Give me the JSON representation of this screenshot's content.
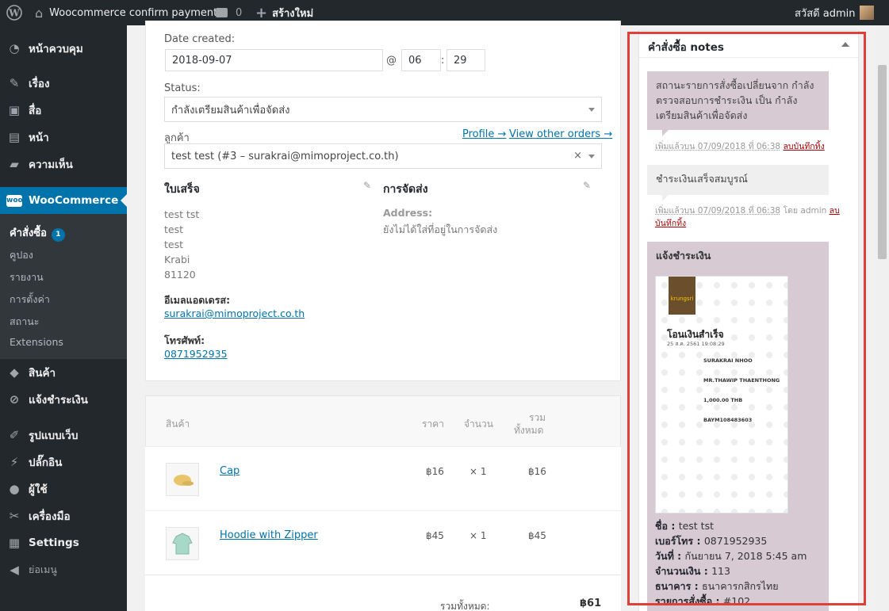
{
  "admin_bar": {
    "site_name": "Woocommerce confirm payment",
    "comments_count": "0",
    "new_label": "สร้างใหม่",
    "greeting": "สวัสดี admin"
  },
  "menu": {
    "items": [
      {
        "label": "หน้าควบคุม",
        "icon": "dashboard-icon"
      },
      {
        "label": "เรื่อง",
        "icon": "pin-icon"
      },
      {
        "label": "สื่อ",
        "icon": "media-icon"
      },
      {
        "label": "หน้า",
        "icon": "page-icon"
      },
      {
        "label": "ความเห็น",
        "icon": "comment-icon"
      },
      {
        "label": "WooCommerce",
        "icon": "woo-icon"
      },
      {
        "label": "สินค้า",
        "icon": "box-icon"
      },
      {
        "label": "แจ้งชำระเงิน",
        "icon": "link-icon"
      },
      {
        "label": "รูปแบบเว็บ",
        "icon": "brush-icon"
      },
      {
        "label": "ปลั๊กอิน",
        "icon": "plugin-icon"
      },
      {
        "label": "ผู้ใช้",
        "icon": "user-icon"
      },
      {
        "label": "เครื่องมือ",
        "icon": "wrench-icon"
      },
      {
        "label": "Settings",
        "icon": "settings-icon"
      },
      {
        "label": "ย่อเมนู",
        "icon": "collapse-icon"
      }
    ],
    "submenu": [
      {
        "label": "คำสั่งซื้อ",
        "badge": "1"
      },
      {
        "label": "คูปอง"
      },
      {
        "label": "รายงาน"
      },
      {
        "label": "การตั้งค่า"
      },
      {
        "label": "สถานะ"
      },
      {
        "label": "Extensions"
      }
    ]
  },
  "order": {
    "date_label": "Date created:",
    "date": "2018-09-07",
    "at": "@",
    "hour": "06",
    "minute": "29",
    "status_label": "Status:",
    "status": "กำลังเตรียมสินค้าเพื่อจัดส่ง",
    "customer_label": "ลูกค้า",
    "profile_link": "Profile →",
    "other_orders_link": "View other orders →",
    "customer": "test test (#3 – surakrai@mimoproject.co.th)",
    "billing_title": "ใบเสร็จ",
    "billing_lines": [
      "test tst",
      "test",
      "test",
      "Krabi",
      "81120"
    ],
    "email_label": "อีเมลแอดเดรส:",
    "email": "surakrai@mimoproject.co.th",
    "phone_label": "โทรศัพท์:",
    "phone": "0871952935",
    "shipping_title": "การจัดส่ง",
    "address_label": "Address:",
    "no_address": "ยังไม่ได้ใส่ที่อยู่ในการจัดส่ง"
  },
  "items": {
    "headers": {
      "product": "สินค้า",
      "price": "ราคา",
      "qty": "จำนวน",
      "total_1": "รวม",
      "total_2": "ทั้งหมด"
    },
    "rows": [
      {
        "name": "Cap",
        "price": "฿16",
        "qty": "× 1",
        "total": "฿16"
      },
      {
        "name": "Hoodie with Zipper",
        "price": "฿45",
        "qty": "× 1",
        "total": "฿45"
      }
    ],
    "grand_label": "รวมทั้งหมด:",
    "grand_total": "฿61"
  },
  "notes": {
    "title": "คำสั่งซื้อ notes",
    "n1_text": "สถานะรายการสั่งซื้อเปลี่ยนจาก กำลังตรวจสอบการชำระเงิน เป็น กำลังเตรียมสินค้าเพื่อจัดส่ง",
    "n1_meta": "เพิ่มแล้วบน 07/09/2018 ที่ 06:38",
    "delete": "ลบบันทึกทิ้ง",
    "n2_text": "ชำระเงินเสร็จสมบูรณ์",
    "n2_meta": "เพิ่มแล้วบน 07/09/2018 ที่ 06:38",
    "n2_by": "โดย admin",
    "delete_a": "ลบ",
    "delete_b": "บันทึกทิ้ง",
    "n3_title": "แจ้งชำระเงิน",
    "slip": {
      "bank": "krungsri",
      "title": "โอนเงินสำเร็จ",
      "date": "25 ส.ค. 2561 19:08:29",
      "from": "SURAKRAI NHOO",
      "to": "MR.THAWIP THAENTHONG",
      "amount": "1,000.00 THB",
      "ref": "BAYM108483603"
    },
    "fields": [
      {
        "k": "ชื่อ",
        "v": "test tst"
      },
      {
        "k": "เบอร์โทร",
        "v": "0871952935"
      },
      {
        "k": "วันที่",
        "v": "กันยายน 7, 2018 5:45 am"
      },
      {
        "k": "จำนวนเงิน",
        "v": "113"
      },
      {
        "k": "ธนาคาร",
        "v": "ธนาคารกสิกรไทย"
      },
      {
        "k": "รายการสั่งซื้อ",
        "v": "#102"
      }
    ]
  },
  "highlight_color": "#e0403a"
}
